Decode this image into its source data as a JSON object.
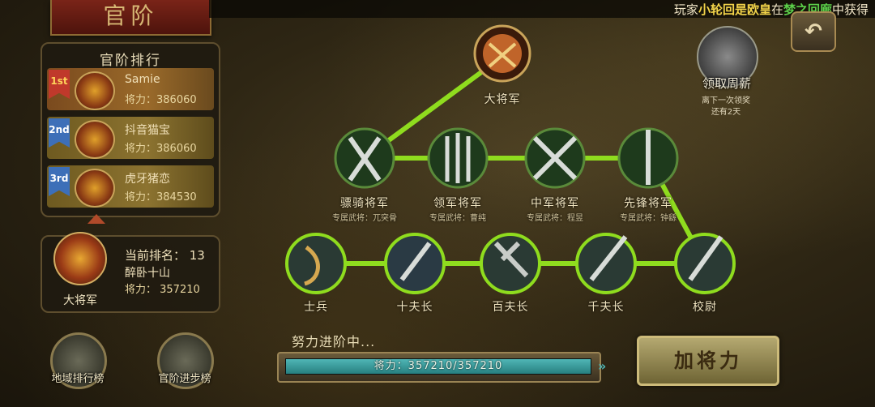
{
  "screen_title": "官阶",
  "marquee": {
    "prefix": "玩家",
    "player": "小轮回是欧皇",
    "mid": "在",
    "place": "梦之回廊",
    "suffix": "中获得"
  },
  "back_icon": "return-arrow-icon",
  "ranking": {
    "title": "官阶排行",
    "entries": [
      {
        "badge": "1st",
        "name": "Samie",
        "power_label": "将力：",
        "power": "386060"
      },
      {
        "badge": "2nd",
        "name": "抖音猫宝",
        "power_label": "将力：",
        "power": "386060"
      },
      {
        "badge": "3rd",
        "name": "虎牙猪恋",
        "power_label": "将力：",
        "power": "384530"
      }
    ]
  },
  "mine": {
    "rank_text": "当前排名： 13",
    "name": "醉卧十山",
    "power_text": "将力： 357210",
    "title": "大将军"
  },
  "buttons": {
    "region_rank": "地域排行榜",
    "rank_progress": "官阶进步榜",
    "add_power": "加将力"
  },
  "weekly": {
    "label": "领取周薪",
    "note_line1": "离下一次领奖",
    "note_line2": "还有2天"
  },
  "tree": {
    "nodes": [
      {
        "id": "top",
        "label": "大将军",
        "sub": ""
      },
      {
        "id": "n1",
        "label": "骠骑将军",
        "sub": "专属武将：兀突骨"
      },
      {
        "id": "n2",
        "label": "领军将军",
        "sub": "专属武将：曹纯"
      },
      {
        "id": "n3",
        "label": "中军将军",
        "sub": "专属武将：程昱"
      },
      {
        "id": "n4",
        "label": "先锋将军",
        "sub": "专属武将：钟繇"
      },
      {
        "id": "b1",
        "label": "士兵",
        "sub": ""
      },
      {
        "id": "b2",
        "label": "十夫长",
        "sub": ""
      },
      {
        "id": "b3",
        "label": "百夫长",
        "sub": ""
      },
      {
        "id": "b4",
        "label": "千夫长",
        "sub": ""
      },
      {
        "id": "b5",
        "label": "校尉",
        "sub": ""
      }
    ]
  },
  "progress": {
    "caption": "努力进阶中...",
    "text": "将力：357210/357210",
    "fraction": 1.0
  },
  "colors": {
    "accent_green": "#8fdc1e",
    "banner_red": "#7a2418",
    "fill_teal": "#4fb5b5"
  }
}
